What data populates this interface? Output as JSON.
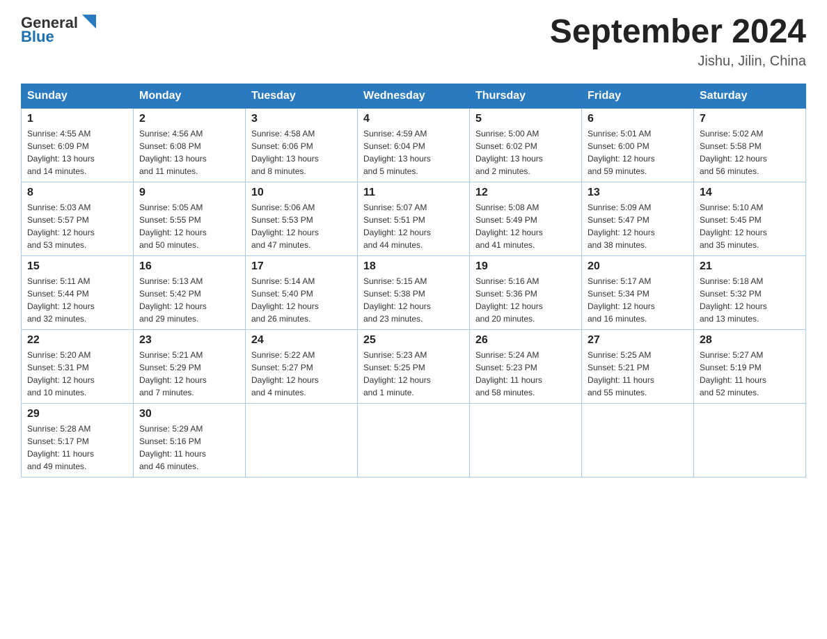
{
  "header": {
    "logo_text_general": "General",
    "logo_text_blue": "Blue",
    "title": "September 2024",
    "subtitle": "Jishu, Jilin, China"
  },
  "days_of_week": [
    "Sunday",
    "Monday",
    "Tuesday",
    "Wednesday",
    "Thursday",
    "Friday",
    "Saturday"
  ],
  "weeks": [
    [
      {
        "day": "1",
        "info": "Sunrise: 4:55 AM\nSunset: 6:09 PM\nDaylight: 13 hours\nand 14 minutes."
      },
      {
        "day": "2",
        "info": "Sunrise: 4:56 AM\nSunset: 6:08 PM\nDaylight: 13 hours\nand 11 minutes."
      },
      {
        "day": "3",
        "info": "Sunrise: 4:58 AM\nSunset: 6:06 PM\nDaylight: 13 hours\nand 8 minutes."
      },
      {
        "day": "4",
        "info": "Sunrise: 4:59 AM\nSunset: 6:04 PM\nDaylight: 13 hours\nand 5 minutes."
      },
      {
        "day": "5",
        "info": "Sunrise: 5:00 AM\nSunset: 6:02 PM\nDaylight: 13 hours\nand 2 minutes."
      },
      {
        "day": "6",
        "info": "Sunrise: 5:01 AM\nSunset: 6:00 PM\nDaylight: 12 hours\nand 59 minutes."
      },
      {
        "day": "7",
        "info": "Sunrise: 5:02 AM\nSunset: 5:58 PM\nDaylight: 12 hours\nand 56 minutes."
      }
    ],
    [
      {
        "day": "8",
        "info": "Sunrise: 5:03 AM\nSunset: 5:57 PM\nDaylight: 12 hours\nand 53 minutes."
      },
      {
        "day": "9",
        "info": "Sunrise: 5:05 AM\nSunset: 5:55 PM\nDaylight: 12 hours\nand 50 minutes."
      },
      {
        "day": "10",
        "info": "Sunrise: 5:06 AM\nSunset: 5:53 PM\nDaylight: 12 hours\nand 47 minutes."
      },
      {
        "day": "11",
        "info": "Sunrise: 5:07 AM\nSunset: 5:51 PM\nDaylight: 12 hours\nand 44 minutes."
      },
      {
        "day": "12",
        "info": "Sunrise: 5:08 AM\nSunset: 5:49 PM\nDaylight: 12 hours\nand 41 minutes."
      },
      {
        "day": "13",
        "info": "Sunrise: 5:09 AM\nSunset: 5:47 PM\nDaylight: 12 hours\nand 38 minutes."
      },
      {
        "day": "14",
        "info": "Sunrise: 5:10 AM\nSunset: 5:45 PM\nDaylight: 12 hours\nand 35 minutes."
      }
    ],
    [
      {
        "day": "15",
        "info": "Sunrise: 5:11 AM\nSunset: 5:44 PM\nDaylight: 12 hours\nand 32 minutes."
      },
      {
        "day": "16",
        "info": "Sunrise: 5:13 AM\nSunset: 5:42 PM\nDaylight: 12 hours\nand 29 minutes."
      },
      {
        "day": "17",
        "info": "Sunrise: 5:14 AM\nSunset: 5:40 PM\nDaylight: 12 hours\nand 26 minutes."
      },
      {
        "day": "18",
        "info": "Sunrise: 5:15 AM\nSunset: 5:38 PM\nDaylight: 12 hours\nand 23 minutes."
      },
      {
        "day": "19",
        "info": "Sunrise: 5:16 AM\nSunset: 5:36 PM\nDaylight: 12 hours\nand 20 minutes."
      },
      {
        "day": "20",
        "info": "Sunrise: 5:17 AM\nSunset: 5:34 PM\nDaylight: 12 hours\nand 16 minutes."
      },
      {
        "day": "21",
        "info": "Sunrise: 5:18 AM\nSunset: 5:32 PM\nDaylight: 12 hours\nand 13 minutes."
      }
    ],
    [
      {
        "day": "22",
        "info": "Sunrise: 5:20 AM\nSunset: 5:31 PM\nDaylight: 12 hours\nand 10 minutes."
      },
      {
        "day": "23",
        "info": "Sunrise: 5:21 AM\nSunset: 5:29 PM\nDaylight: 12 hours\nand 7 minutes."
      },
      {
        "day": "24",
        "info": "Sunrise: 5:22 AM\nSunset: 5:27 PM\nDaylight: 12 hours\nand 4 minutes."
      },
      {
        "day": "25",
        "info": "Sunrise: 5:23 AM\nSunset: 5:25 PM\nDaylight: 12 hours\nand 1 minute."
      },
      {
        "day": "26",
        "info": "Sunrise: 5:24 AM\nSunset: 5:23 PM\nDaylight: 11 hours\nand 58 minutes."
      },
      {
        "day": "27",
        "info": "Sunrise: 5:25 AM\nSunset: 5:21 PM\nDaylight: 11 hours\nand 55 minutes."
      },
      {
        "day": "28",
        "info": "Sunrise: 5:27 AM\nSunset: 5:19 PM\nDaylight: 11 hours\nand 52 minutes."
      }
    ],
    [
      {
        "day": "29",
        "info": "Sunrise: 5:28 AM\nSunset: 5:17 PM\nDaylight: 11 hours\nand 49 minutes."
      },
      {
        "day": "30",
        "info": "Sunrise: 5:29 AM\nSunset: 5:16 PM\nDaylight: 11 hours\nand 46 minutes."
      },
      {
        "day": "",
        "info": ""
      },
      {
        "day": "",
        "info": ""
      },
      {
        "day": "",
        "info": ""
      },
      {
        "day": "",
        "info": ""
      },
      {
        "day": "",
        "info": ""
      }
    ]
  ]
}
